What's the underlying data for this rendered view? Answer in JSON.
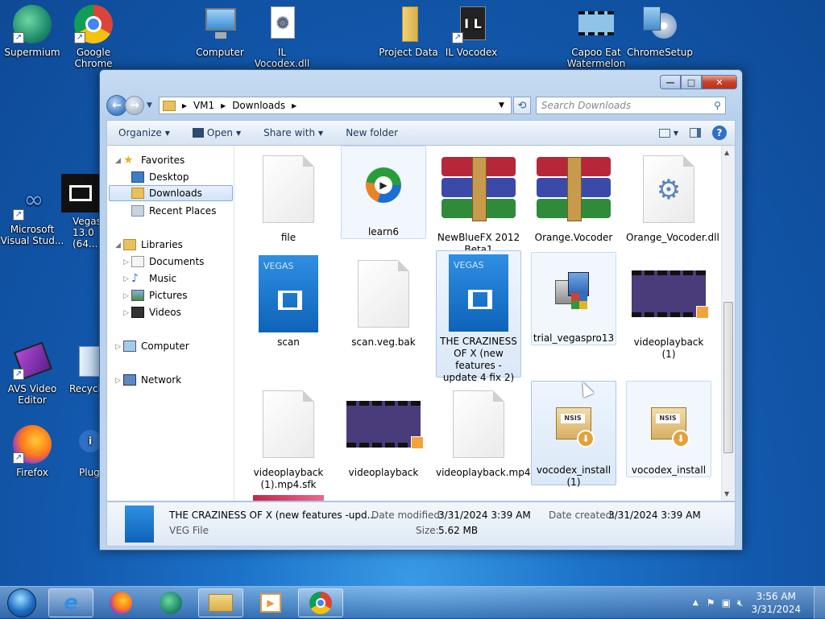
{
  "desktop": {
    "icons": [
      {
        "label": "Supermium"
      },
      {
        "label": "Google Chrome"
      },
      {
        "label": "Computer"
      },
      {
        "label": "IL Vocodex.dll"
      },
      {
        "label": "Project Data"
      },
      {
        "label": "IL Vocodex"
      },
      {
        "label": "Capoo Eat Watermelon"
      },
      {
        "label": "ChromeSetup"
      },
      {
        "label": "Microsoft Visual Stud..."
      },
      {
        "label": "Vegas 13.0 (64..."
      },
      {
        "label": "AVS Video Editor"
      },
      {
        "label": "Recycle..."
      },
      {
        "label": "Firefox"
      },
      {
        "label": "Plug..."
      }
    ]
  },
  "window": {
    "controls": {
      "minimize": "—",
      "maximize": "□",
      "close": "✕"
    },
    "breadcrumb": [
      "VM1",
      "Downloads"
    ],
    "search_placeholder": "Search Downloads",
    "toolbar": {
      "organize": "Organize",
      "open": "Open",
      "share_with": "Share with",
      "new_folder": "New folder"
    },
    "nav_pane": {
      "favorites": "Favorites",
      "desktop": "Desktop",
      "downloads": "Downloads",
      "recent_places": "Recent Places",
      "libraries": "Libraries",
      "documents": "Documents",
      "music": "Music",
      "pictures": "Pictures",
      "videos": "Videos",
      "computer": "Computer",
      "network": "Network"
    },
    "files": [
      {
        "name": "file",
        "icon": "doc"
      },
      {
        "name": "learn6",
        "icon": "media"
      },
      {
        "name": "NewBlueFX 2012 Beta1",
        "icon": "rar"
      },
      {
        "name": "Orange.Vocoder",
        "icon": "rar"
      },
      {
        "name": "Orange_Vocoder.dll",
        "icon": "dll"
      },
      {
        "name": "scan",
        "icon": "vegas"
      },
      {
        "name": "scan.veg.bak",
        "icon": "doc"
      },
      {
        "name": "THE CRAZINESS OF X (new features -update 4 fix 2)",
        "icon": "vegas"
      },
      {
        "name": "trial_vegaspro13",
        "icon": "installer"
      },
      {
        "name": "videoplayback (1)",
        "icon": "video"
      },
      {
        "name": "videoplayback (1).mp4.sfk",
        "icon": "doc"
      },
      {
        "name": "videoplayback",
        "icon": "video"
      },
      {
        "name": "videoplayback.mp4.sfk",
        "icon": "doc"
      },
      {
        "name": "vocodex_install (1)",
        "icon": "nsis"
      },
      {
        "name": "vocodex_install",
        "icon": "nsis"
      }
    ],
    "details": {
      "name": "THE CRAZINESS OF X (new features -upd...",
      "type": "VEG File",
      "date_modified_label": "Date modified:",
      "date_modified": "3/31/2024 3:39 AM",
      "size_label": "Size:",
      "size": "5.62 MB",
      "date_created_label": "Date created:",
      "date_created": "3/31/2024 3:39 AM"
    }
  },
  "taskbar": {
    "time": "3:56 AM",
    "date": "3/31/2024"
  },
  "colors": {
    "selection": "#cfe3f9",
    "desktop": "#1c72c9",
    "vegas_blue": "#0e63b8"
  }
}
